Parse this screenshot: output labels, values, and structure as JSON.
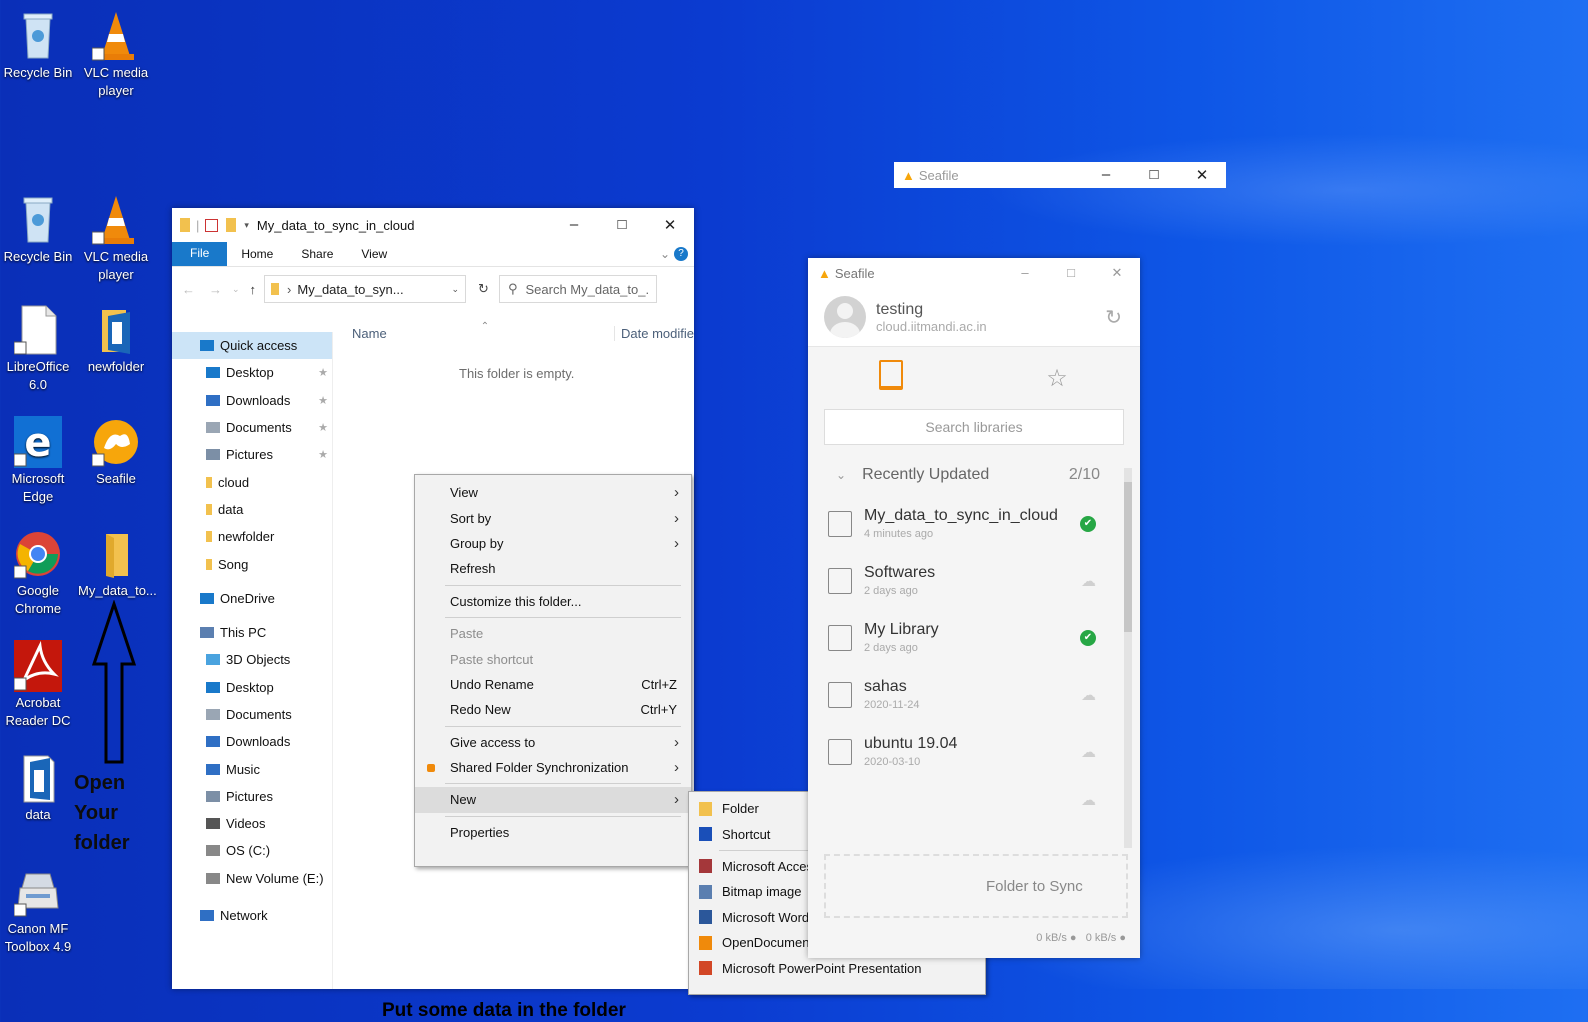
{
  "desktop": {
    "icons": [
      {
        "label": "Recycle Bin",
        "icon": "recycle-bin-icon"
      },
      {
        "label": "VLC media player",
        "icon": "vlc-icon"
      },
      {
        "label": "Recycle Bin",
        "icon": "recycle-bin-icon"
      },
      {
        "label": "VLC media player",
        "icon": "vlc-icon"
      },
      {
        "label": "LibreOffice 6.0",
        "icon": "document-icon"
      },
      {
        "label": "newfolder",
        "icon": "folder-icon"
      },
      {
        "label": "Microsoft Edge",
        "icon": "edge-icon"
      },
      {
        "label": "Seafile",
        "icon": "seafile-icon"
      },
      {
        "label": "Google Chrome",
        "icon": "chrome-icon"
      },
      {
        "label": "My_data_to...",
        "icon": "folder-icon"
      },
      {
        "label": "Acrobat Reader DC",
        "icon": "acrobat-icon"
      },
      {
        "label": "data",
        "icon": "document-icon"
      },
      {
        "label": "Canon MF Toolbox 4.9",
        "icon": "printer-icon"
      }
    ],
    "annotation_open": "Open Your folder",
    "annotation_put": "Put some data in the folder"
  },
  "explorer": {
    "title": "My_data_to_sync_in_cloud",
    "ribbon": {
      "file": "File",
      "home": "Home",
      "share": "Share",
      "view": "View"
    },
    "address": "My_data_to_syn...",
    "search_placeholder": "Search My_data_to_...",
    "columns": {
      "name": "Name",
      "date": "Date modifie"
    },
    "empty_text": "This folder is empty.",
    "nav": [
      {
        "label": "Quick access",
        "icon": "star-icon"
      },
      {
        "label": "Desktop",
        "icon": "desktop-icon",
        "pinned": true
      },
      {
        "label": "Downloads",
        "icon": "download-icon",
        "pinned": true
      },
      {
        "label": "Documents",
        "icon": "documents-icon",
        "pinned": true
      },
      {
        "label": "Pictures",
        "icon": "pictures-icon",
        "pinned": true
      },
      {
        "label": "cloud",
        "icon": "folder-icon"
      },
      {
        "label": "data",
        "icon": "folder-icon"
      },
      {
        "label": "newfolder",
        "icon": "folder-icon"
      },
      {
        "label": "Song",
        "icon": "folder-icon"
      },
      {
        "label": "OneDrive",
        "icon": "cloud-icon"
      },
      {
        "label": "This PC",
        "icon": "pc-icon"
      },
      {
        "label": "3D Objects",
        "icon": "cube-icon"
      },
      {
        "label": "Desktop",
        "icon": "desktop-icon"
      },
      {
        "label": "Documents",
        "icon": "documents-icon"
      },
      {
        "label": "Downloads",
        "icon": "download-icon"
      },
      {
        "label": "Music",
        "icon": "music-icon"
      },
      {
        "label": "Pictures",
        "icon": "pictures-icon"
      },
      {
        "label": "Videos",
        "icon": "videos-icon"
      },
      {
        "label": "OS (C:)",
        "icon": "drive-icon"
      },
      {
        "label": "New Volume (E:)",
        "icon": "drive-icon"
      },
      {
        "label": "Network",
        "icon": "network-icon"
      }
    ]
  },
  "context_menu": {
    "items": [
      {
        "label": "View",
        "submenu": true
      },
      {
        "label": "Sort by",
        "submenu": true
      },
      {
        "label": "Group by",
        "submenu": true
      },
      {
        "label": "Refresh"
      },
      {
        "sep": true
      },
      {
        "label": "Customize this folder..."
      },
      {
        "sep": true
      },
      {
        "label": "Paste",
        "disabled": true
      },
      {
        "label": "Paste shortcut",
        "disabled": true
      },
      {
        "label": "Undo Rename",
        "shortcut": "Ctrl+Z"
      },
      {
        "label": "Redo New",
        "shortcut": "Ctrl+Y"
      },
      {
        "sep": true
      },
      {
        "label": "Give access to",
        "submenu": true
      },
      {
        "label": "Shared Folder Synchronization",
        "submenu": true
      },
      {
        "sep": true
      },
      {
        "label": "New",
        "submenu": true,
        "highlight": true
      },
      {
        "sep": true
      },
      {
        "label": "Properties"
      }
    ]
  },
  "new_submenu": {
    "items": [
      {
        "label": "Folder",
        "icon": "folder-icon"
      },
      {
        "label": "Shortcut",
        "icon": "shortcut-icon"
      },
      {
        "sep": true
      },
      {
        "label": "Microsoft Access Database",
        "icon": "access-icon"
      },
      {
        "label": "Bitmap image",
        "icon": "bitmap-icon"
      },
      {
        "label": "Microsoft Word Document",
        "icon": "word-icon"
      },
      {
        "label": "OpenDocument Drawing",
        "icon": "drawing-icon"
      },
      {
        "label": "Microsoft PowerPoint Presentation",
        "icon": "powerpoint-icon"
      }
    ]
  },
  "seafile_back": {
    "title": "Seafile"
  },
  "seafile": {
    "title": "Seafile",
    "account_name": "testing",
    "server": "cloud.iitmandi.ac.in",
    "search_placeholder": "Search libraries",
    "section": "Recently Updated",
    "count": "2/10",
    "libraries": [
      {
        "name": "My_data_to_sync_in_cloud",
        "time": "4 minutes ago",
        "synced": true
      },
      {
        "name": "Softwares",
        "time": "2 days ago",
        "synced": false
      },
      {
        "name": "My Library",
        "time": "2 days ago",
        "synced": true
      },
      {
        "name": "sahas",
        "time": "2020-11-24",
        "synced": false
      },
      {
        "name": "ubuntu 19.04",
        "time": "2020-03-10",
        "synced": false
      }
    ],
    "dropzone": "Folder to Sync",
    "rate_down": "0 kB/s",
    "rate_up": "0 kB/s"
  }
}
